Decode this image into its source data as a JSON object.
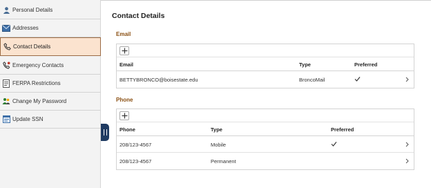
{
  "sidebar": {
    "items": [
      {
        "label": "Personal Details",
        "icon": "person-icon",
        "active": false
      },
      {
        "label": "Addresses",
        "icon": "envelope-icon",
        "active": false
      },
      {
        "label": "Contact Details",
        "icon": "phone-icon",
        "active": true
      },
      {
        "label": "Emergency Contacts",
        "icon": "emergency-phone-icon",
        "active": false
      },
      {
        "label": "FERPA Restrictions",
        "icon": "document-icon",
        "active": false
      },
      {
        "label": "Change My Password",
        "icon": "people-icon",
        "active": false
      },
      {
        "label": "Update SSN",
        "icon": "form-icon",
        "active": false
      }
    ],
    "active_color": "#fbe3cf",
    "collapse_icon": "collapse-handle-icon"
  },
  "main": {
    "title": "Contact Details",
    "email": {
      "section_title": "Email",
      "add_icon": "plus-icon",
      "columns": [
        "Email",
        "Type",
        "Preferred"
      ],
      "rows": [
        {
          "value": "BETTYBRONCO@boisestate.edu",
          "type": "BroncoMail",
          "preferred": true
        }
      ]
    },
    "phone": {
      "section_title": "Phone",
      "add_icon": "plus-icon",
      "columns": [
        "Phone",
        "Type",
        "Preferred"
      ],
      "rows": [
        {
          "value": "208/123-4567",
          "type": "Mobile",
          "preferred": true
        },
        {
          "value": "208/123-4567",
          "type": "Permanent",
          "preferred": false
        }
      ]
    },
    "section_title_color": "#8a4f12"
  }
}
